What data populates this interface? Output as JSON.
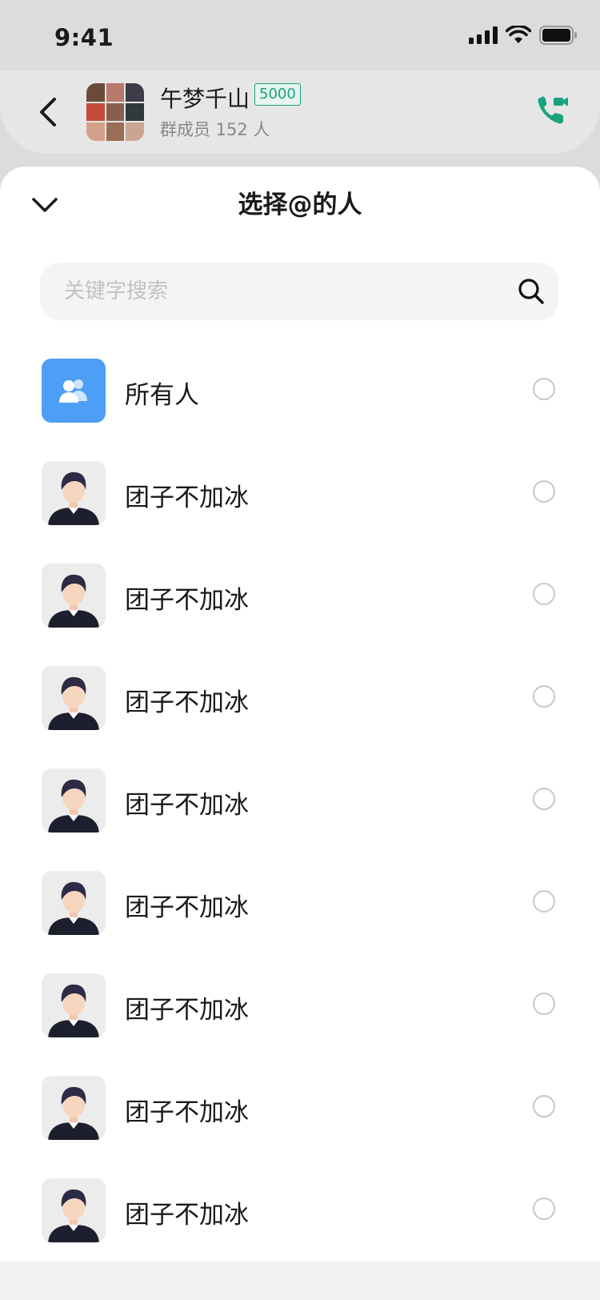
{
  "status_bar": {
    "time": "9:41"
  },
  "header": {
    "group_name": "午梦千山",
    "member_badge": "5000",
    "member_count": "群成员 152 人",
    "accent": "#1aa37f"
  },
  "sheet": {
    "title": "选择@的人",
    "search_placeholder": "关键字搜索"
  },
  "all_item": {
    "label": "所有人",
    "color": "#4d9ef5",
    "icon": "group-people-icon"
  },
  "members": [
    {
      "name": "团子不加冰"
    },
    {
      "name": "团子不加冰"
    },
    {
      "name": "团子不加冰"
    },
    {
      "name": "团子不加冰"
    },
    {
      "name": "团子不加冰"
    },
    {
      "name": "团子不加冰"
    },
    {
      "name": "团子不加冰"
    },
    {
      "name": "团子不加冰"
    }
  ]
}
